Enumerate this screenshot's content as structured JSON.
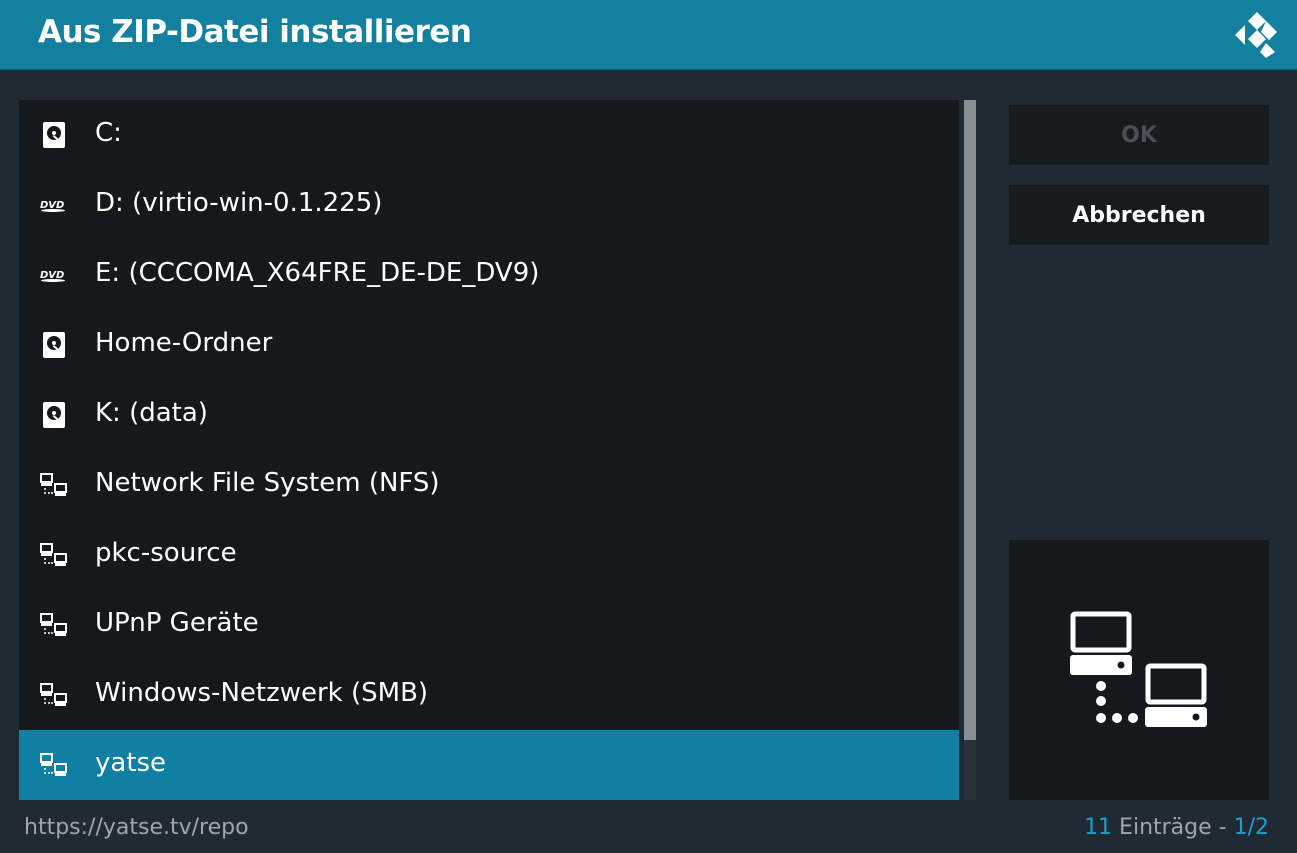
{
  "dialog": {
    "title": "Aus ZIP-Datei installieren"
  },
  "list": {
    "items": [
      {
        "label": "C:",
        "icon": "harddisk-icon"
      },
      {
        "label": "D: (virtio-win-0.1.225)",
        "icon": "dvd-icon"
      },
      {
        "label": "E: (CCCOMA_X64FRE_DE-DE_DV9)",
        "icon": "dvd-icon"
      },
      {
        "label": "Home-Ordner",
        "icon": "harddisk-icon"
      },
      {
        "label": "K: (data)",
        "icon": "harddisk-icon"
      },
      {
        "label": "Network File System (NFS)",
        "icon": "network-icon"
      },
      {
        "label": "pkc-source",
        "icon": "network-icon"
      },
      {
        "label": "UPnP Geräte",
        "icon": "network-icon"
      },
      {
        "label": "Windows-Netzwerk (SMB)",
        "icon": "network-icon"
      },
      {
        "label": "yatse",
        "icon": "network-icon",
        "selected": true
      }
    ]
  },
  "buttons": {
    "ok_label": "OK",
    "cancel_label": "Abbrechen"
  },
  "footer": {
    "path": "https://yatse.tv/repo",
    "count": "11",
    "entries_label": " Einträge - ",
    "page": "1/2"
  },
  "colors": {
    "header": "#14809f",
    "selection": "#0f7fa3",
    "accent": "#1aa0c8",
    "panel": "#15191d"
  }
}
